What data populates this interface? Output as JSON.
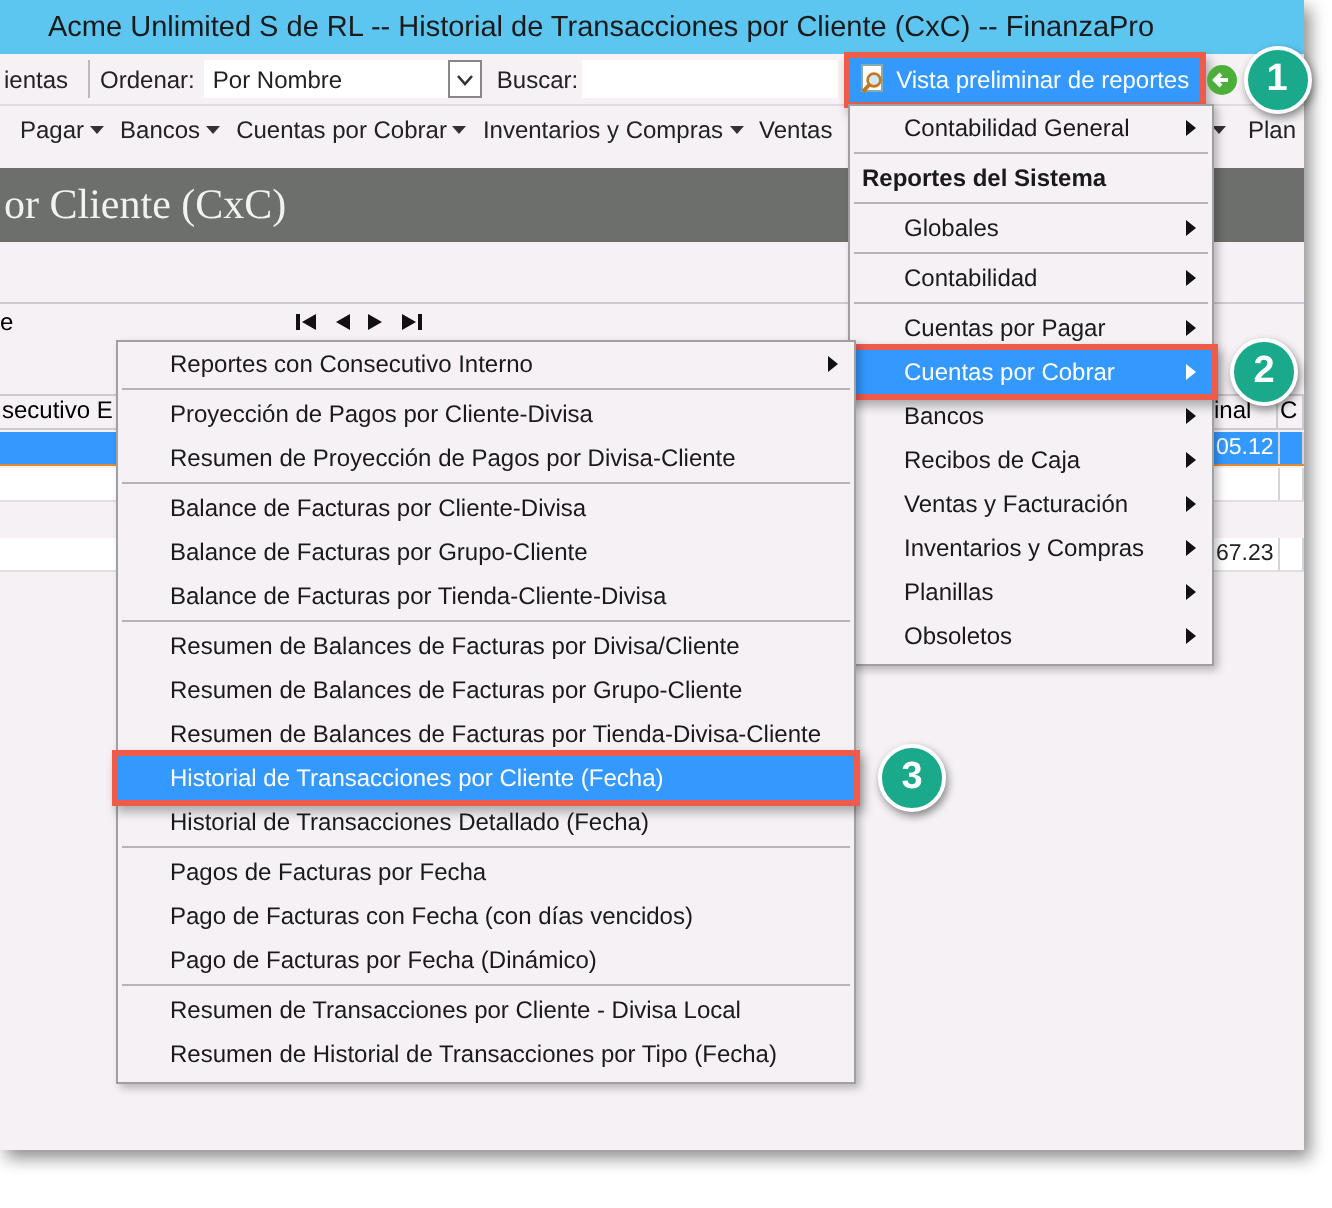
{
  "window": {
    "title": "Acme Unlimited S de RL -- Historial de Transacciones por Cliente (CxC) -- FinanzaPro"
  },
  "toolbar": {
    "cut_label": "ientas",
    "sort": {
      "label": "Ordenar:",
      "value": "Por Nombre"
    },
    "search": {
      "label": "Buscar:"
    },
    "preview_button": {
      "label": "Vista preliminar de reportes",
      "selected": true,
      "callout": "1"
    }
  },
  "menu_bar": [
    {
      "label": "Pagar",
      "caret": true
    },
    {
      "label": "Bancos",
      "caret": true
    },
    {
      "label": "Cuentas por Cobrar",
      "caret": true
    },
    {
      "label": "Inventarios y Compras",
      "caret": true
    },
    {
      "label": "Ventas",
      "caret": false
    },
    {
      "caret": true
    },
    {
      "label": "Plan",
      "caret": false
    }
  ],
  "header": {
    "title": "or Cliente (CxC)"
  },
  "navigator": {
    "cut_label": "e"
  },
  "grid": {
    "columns": [
      "secutivo E",
      "inal",
      "C"
    ],
    "rows": [
      {
        "selected": true,
        "value": "05.12"
      },
      {
        "selected": false
      },
      {
        "selected": false,
        "value": "67.23"
      }
    ]
  },
  "reports_menu": {
    "items": [
      {
        "kind": "item",
        "label": "Contabilidad General",
        "submenu": true,
        "selected": false
      },
      {
        "kind": "separator"
      },
      {
        "kind": "header",
        "label": "Reportes del Sistema"
      },
      {
        "kind": "separator"
      },
      {
        "kind": "item",
        "label": "Globales",
        "submenu": true,
        "selected": false
      },
      {
        "kind": "separator"
      },
      {
        "kind": "item",
        "label": "Contabilidad",
        "submenu": true,
        "selected": false
      },
      {
        "kind": "separator"
      },
      {
        "kind": "item",
        "label": "Cuentas por Pagar",
        "submenu": true,
        "selected": false
      },
      {
        "kind": "item",
        "label": "Cuentas por Cobrar",
        "submenu": true,
        "selected": true,
        "callout": "2"
      },
      {
        "kind": "item",
        "label": "Bancos",
        "submenu": true,
        "selected": false
      },
      {
        "kind": "item",
        "label": "Recibos de Caja",
        "submenu": true,
        "selected": false
      },
      {
        "kind": "item",
        "label": "Ventas y Facturación",
        "submenu": true,
        "selected": false
      },
      {
        "kind": "item",
        "label": "Inventarios y Compras",
        "submenu": true,
        "selected": false
      },
      {
        "kind": "item",
        "label": "Planillas",
        "submenu": true,
        "selected": false
      },
      {
        "kind": "item",
        "label": "Obsoletos",
        "submenu": true,
        "selected": false
      }
    ]
  },
  "submenu": {
    "items": [
      {
        "kind": "item",
        "label": "Reportes con Consecutivo Interno",
        "submenu": true,
        "selected": false
      },
      {
        "kind": "separator"
      },
      {
        "kind": "item",
        "label": "Proyección de Pagos por Cliente-Divisa",
        "submenu": false,
        "selected": false
      },
      {
        "kind": "item",
        "label": "Resumen de Proyección de Pagos por Divisa-Cliente",
        "submenu": false,
        "selected": false
      },
      {
        "kind": "separator"
      },
      {
        "kind": "item",
        "label": "Balance de Facturas por Cliente-Divisa",
        "submenu": false,
        "selected": false
      },
      {
        "kind": "item",
        "label": "Balance de Facturas por Grupo-Cliente",
        "submenu": false,
        "selected": false
      },
      {
        "kind": "item",
        "label": "Balance de Facturas por Tienda-Cliente-Divisa",
        "submenu": false,
        "selected": false
      },
      {
        "kind": "separator"
      },
      {
        "kind": "item",
        "label": "Resumen de Balances de Facturas por Divisa/Cliente",
        "submenu": false,
        "selected": false
      },
      {
        "kind": "item",
        "label": "Resumen de Balances de Facturas por Grupo-Cliente",
        "submenu": false,
        "selected": false
      },
      {
        "kind": "item",
        "label": "Resumen de Balances de Facturas por Tienda-Divisa-Cliente",
        "submenu": false,
        "selected": false
      },
      {
        "kind": "item",
        "label": "Historial de Transacciones por Cliente (Fecha)",
        "submenu": false,
        "selected": true,
        "callout": "3"
      },
      {
        "kind": "item",
        "label": "Historial de Transacciones Detallado (Fecha)",
        "submenu": false,
        "selected": false
      },
      {
        "kind": "separator"
      },
      {
        "kind": "item",
        "label": "Pagos de Facturas por Fecha",
        "submenu": false,
        "selected": false
      },
      {
        "kind": "item",
        "label": "Pago de Facturas con Fecha (con días vencidos)",
        "submenu": false,
        "selected": false
      },
      {
        "kind": "item",
        "label": "Pago de Facturas por Fecha (Dinámico)",
        "submenu": false,
        "selected": false
      },
      {
        "kind": "separator"
      },
      {
        "kind": "item",
        "label": "Resumen de Transacciones por Cliente - Divisa Local",
        "submenu": false,
        "selected": false
      },
      {
        "kind": "item",
        "label": "Resumen de Historial de Transacciones por Tipo (Fecha)",
        "submenu": false,
        "selected": false
      }
    ]
  }
}
